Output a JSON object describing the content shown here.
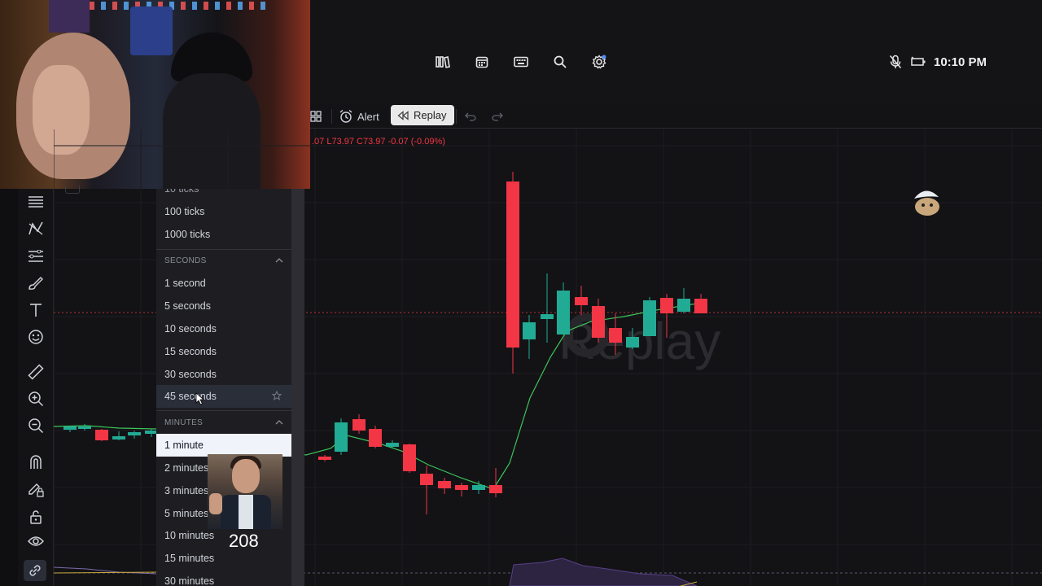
{
  "topbar": {
    "time": "10:10 PM",
    "icons": [
      "library-icon",
      "calendar-icon",
      "keyboard-icon",
      "search-icon",
      "settings-icon"
    ],
    "status_icons": [
      "mic-muted-icon",
      "battery-icon"
    ]
  },
  "chart_toolbar": {
    "alert_label": "Alert",
    "replay_label": "Replay"
  },
  "ohlc_text": ".07 L73.97 C73.97 -0.07 (-0.09%)",
  "watermark": "Replay",
  "left_toolbar": {
    "tools": [
      "menu-lines-icon",
      "pattern-icon",
      "fib-icon",
      "brush-icon",
      "text-icon",
      "emoji-icon",
      "ruler-icon",
      "zoom-in-icon",
      "zoom-out-icon",
      "magnet-icon",
      "pencil-lock-icon",
      "lock-icon",
      "eye-icon",
      "link-icon"
    ]
  },
  "interval_dropdown": {
    "top_partial": "10 ticks",
    "ticks": [
      "100 ticks",
      "1000 ticks"
    ],
    "seconds_header": "SECONDS",
    "seconds": [
      "1 second",
      "5 seconds",
      "10 seconds",
      "15 seconds",
      "30 seconds",
      "45 seconds"
    ],
    "minutes_header": "MINUTES",
    "minutes": [
      "1 minute",
      "2 minutes",
      "3 minutes",
      "5 minutes",
      "10 minutes",
      "15 minutes",
      "30 minutes"
    ],
    "selected": "1 minute",
    "hovered": "45 seconds"
  },
  "overlay": {
    "counter": "208"
  },
  "colors": {
    "up": "#22ab94",
    "down": "#f23645",
    "ma_line": "#3cc45a",
    "background": "#131316"
  }
}
